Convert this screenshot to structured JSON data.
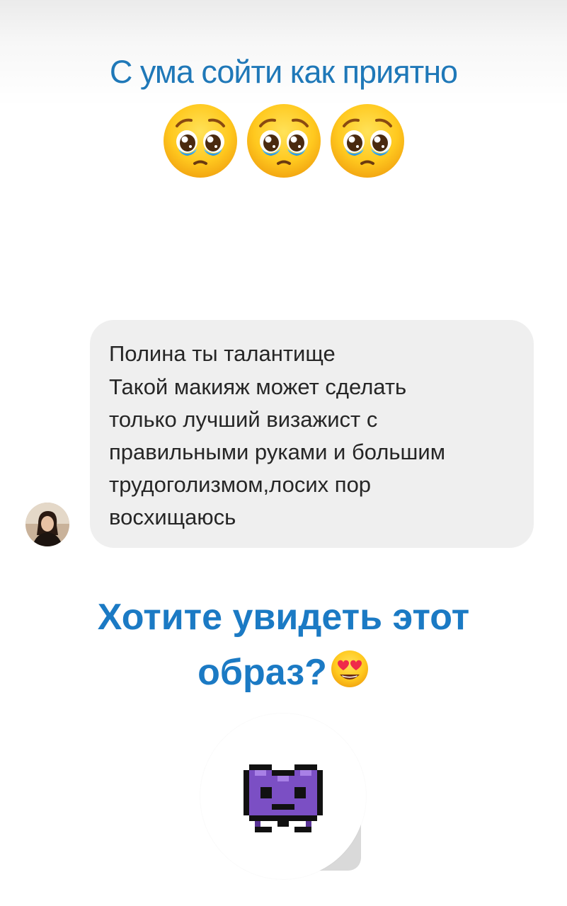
{
  "story": {
    "caption": "С ума сойти как приятно",
    "caption_emojis": [
      "pleading-face-icon",
      "pleading-face-icon",
      "pleading-face-icon"
    ]
  },
  "message": {
    "lines": [
      "Полина ты талантище",
      "Такой макияж может сделать",
      "только лучший визажист с",
      "правильными руками и большим",
      "трудоголизмом,лосих пор",
      "восхищаюсь"
    ],
    "bubble_color": "#efefef",
    "avatar_icon": "user-avatar"
  },
  "question": {
    "line1": "Хотите увидеть этот",
    "line2": "образ?",
    "emoji": "heart-eyes-face-icon",
    "color": "#1b7ac4"
  },
  "reaction": {
    "emoji": "alien-monster-icon"
  },
  "colors": {
    "caption": "#1f78b8",
    "question": "#1b7ac4",
    "text": "#262626"
  }
}
